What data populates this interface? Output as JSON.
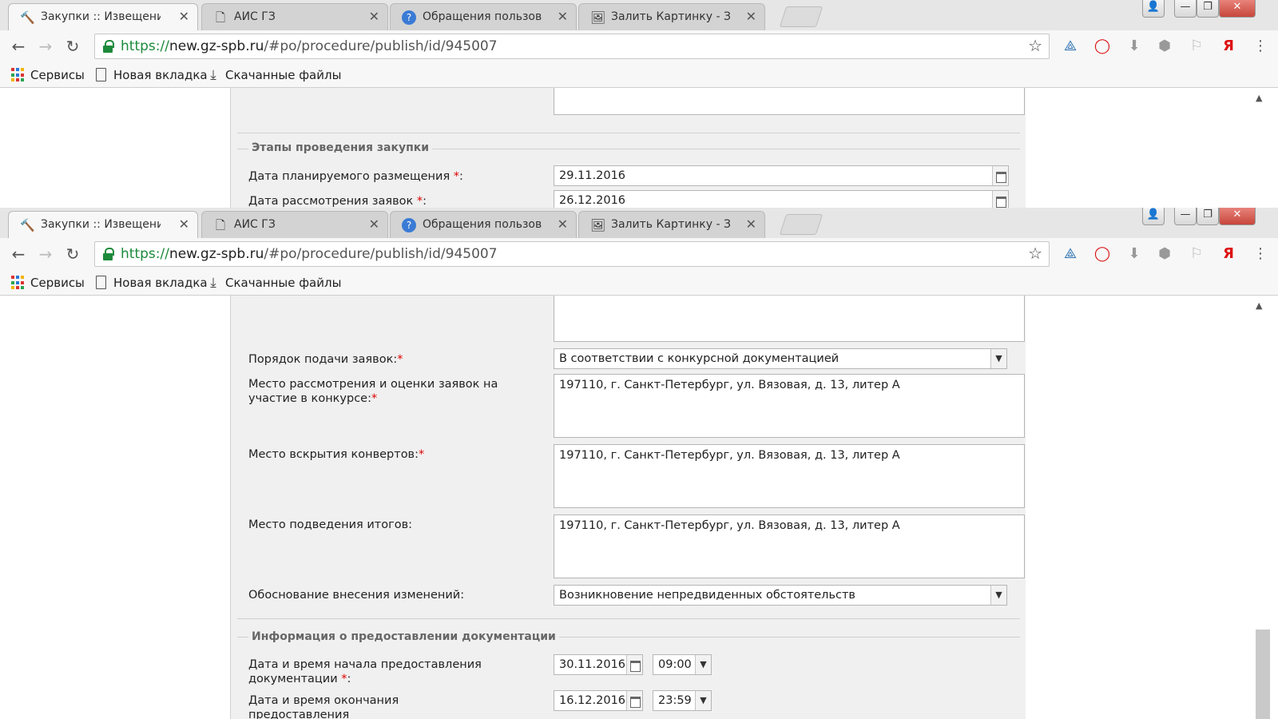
{
  "browser": {
    "tabs": [
      {
        "title": "Закупки :: Извещение о",
        "icon": "gavel-icon",
        "active": true
      },
      {
        "title": "АИС ГЗ",
        "icon": "page-icon",
        "active": false
      },
      {
        "title": "Обращения пользовате",
        "icon": "help-icon",
        "active": false
      },
      {
        "title": "Залить Картинку - Загру",
        "icon": "image-icon",
        "active": false
      }
    ],
    "url": {
      "scheme": "https://",
      "host": "new.gz-spb.ru",
      "path": "/#po/procedure/publish/id/945007"
    },
    "bookmarks": [
      {
        "label": "Сервисы",
        "icon": "apps-grid-icon"
      },
      {
        "label": "Новая вкладка",
        "icon": "page-icon"
      },
      {
        "label": "Скачанные файлы",
        "icon": "download-icon"
      }
    ],
    "extension_icons": [
      "sync-icon",
      "opera-icon",
      "download-icon",
      "adblock-icon",
      "flag-icon",
      "yandex-icon",
      "menu-icon"
    ],
    "yandex_label": "Я"
  },
  "top_view": {
    "section_title": "Этапы проведения закупки",
    "fields": [
      {
        "label": "Дата планируемого размещения",
        "required_mark": "*",
        "value": "29.11.2016"
      },
      {
        "label": "Дата рассмотрения заявок",
        "required_mark": "*",
        "value": "26.12.2016"
      }
    ],
    "colon": ":"
  },
  "bottom_view": {
    "fields": [
      {
        "label": "Порядок подачи заявок:",
        "required_mark": "*",
        "value": "В соответствии с конкурсной документацией",
        "type": "select"
      },
      {
        "label": "Место рассмотрения и оценки заявок на участие в конкурсе:",
        "required_mark": "*",
        "value": "197110, г. Санкт-Петербург, ул. Вязовая, д. 13, литер А",
        "type": "textarea"
      },
      {
        "label": "Место вскрытия конвертов:",
        "required_mark": "*",
        "value": "197110, г. Санкт-Петербург, ул. Вязовая, д. 13, литер А",
        "type": "textarea"
      },
      {
        "label": "Место подведения итогов:",
        "required_mark": "",
        "value": "197110, г. Санкт-Петербург, ул. Вязовая, д. 13, литер А",
        "type": "textarea"
      },
      {
        "label": "Обоснование внесения изменений:",
        "required_mark": "",
        "value": "Возникновение непредвиденных обстоятельств",
        "type": "select"
      }
    ],
    "doc_section_title": "Информация о предоставлении документации",
    "doc_fields": [
      {
        "label": "Дата и время начала предоставления документации",
        "required_mark": "*",
        "colon": ":",
        "date": "30.11.2016",
        "time": "09:00"
      },
      {
        "label": "Дата и время окончания предоставления",
        "date": "16.12.2016",
        "time": "23:59"
      }
    ]
  },
  "window_controls": {
    "minimize": "—",
    "maximize": "❐",
    "close": "✕",
    "user": "👤"
  },
  "colors": {
    "required": "#dd0000",
    "https": "#1c8a3a",
    "panel_bg": "#f0f0f0"
  }
}
